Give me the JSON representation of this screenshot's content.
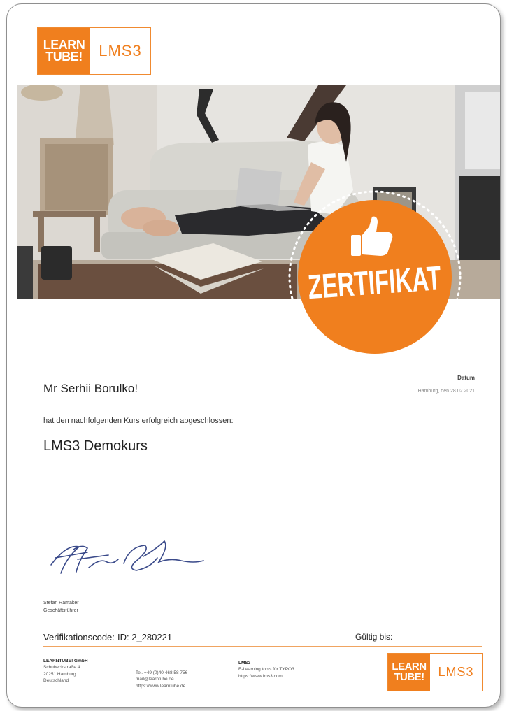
{
  "logo": {
    "learn": "LEARN",
    "tube": "TUBE!",
    "product": "LMS3"
  },
  "stamp": {
    "text": "ZERTIFIKAT"
  },
  "recipient": "Mr Serhii Borulko!",
  "completed_text": "hat den nachfolgenden Kurs erfolgreich abgeschlossen:",
  "course": "LMS3 Demokurs",
  "date": {
    "label": "Datum",
    "value": "Hamburg, den 28.02.2021"
  },
  "signer": {
    "name": "Stefan Ramaker",
    "role": "Geschäftsführer"
  },
  "verification": {
    "label": "Verifikationscode:",
    "code": "ID: 2_280221"
  },
  "valid_until_label": "Gültig bis:",
  "footer": {
    "company": {
      "name": "LEARNTUBE! GmbH",
      "street": "Schubeckstraße 4",
      "city": "20251 Hamburg",
      "country": "Deutschland"
    },
    "contact": {
      "tel": "Tel. +49 (0)40 468 58 756",
      "mail": "mail@learntube.de",
      "web": "https://www.learntube.de"
    },
    "product": {
      "name": "LMS3",
      "desc": "E-Learning tools für TYPO3",
      "web": "https://www.lms3.com"
    }
  },
  "colors": {
    "brand_orange": "#f07f1e",
    "rule": "#f0a461"
  }
}
